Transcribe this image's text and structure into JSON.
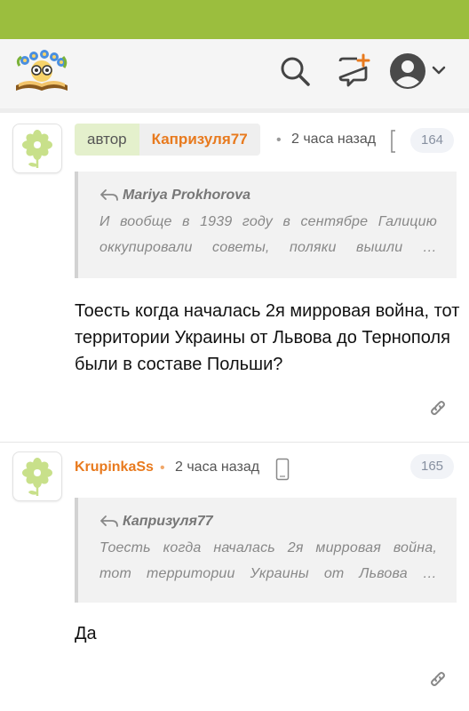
{
  "header": {
    "logo_icon": "book-with-glasses-logo",
    "search_icon": "search-icon",
    "new_icon": "new-message-icon",
    "user_icon": "user-avatar-icon",
    "menu_icon": "chevron-down-icon",
    "brand_color": "#9bbe3e"
  },
  "comments": [
    {
      "author_role": "автор",
      "author": "Капризуля77",
      "time": "2 часа назад",
      "number": "164",
      "quote_author": "Mariya Prokhorova",
      "quote_line1": "И вообще в 1939 году в сентябре Галицию",
      "quote_line2": "оккупировали советы, поляки вышли …",
      "text": "Тоесть когда началась 2я мирровая война, тот территории Украины от Львова до Тернополя были в составе Польши?"
    },
    {
      "author": "KrupinkaSs",
      "time": "2 часа назад",
      "number": "165",
      "quote_author": "Капризуля77",
      "quote_line1": "Тоесть когда началась 2я мирровая война,",
      "quote_line2": "тот территории Украины от Львова …",
      "text": "Да"
    }
  ],
  "colors": {
    "accent_orange": "#e87a1e",
    "role_badge_bg": "#e4f0cc"
  }
}
